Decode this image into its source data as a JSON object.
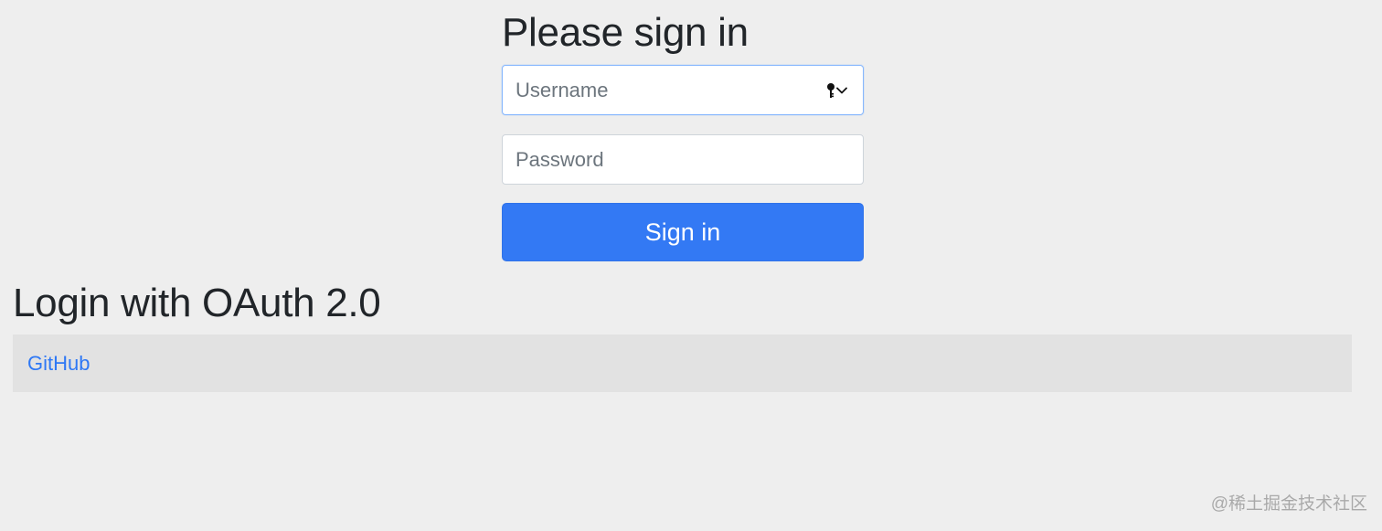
{
  "signin": {
    "heading": "Please sign in",
    "username": {
      "placeholder": "Username",
      "value": ""
    },
    "password": {
      "placeholder": "Password",
      "value": ""
    },
    "submit_label": "Sign in",
    "autofill_icon": "key-icon",
    "autofill_chevron_icon": "chevron-down-icon"
  },
  "oauth": {
    "heading": "Login with OAuth 2.0",
    "providers": [
      {
        "label": "GitHub"
      }
    ]
  },
  "watermark": "@稀土掘金技术社区",
  "colors": {
    "background": "#eeeeee",
    "primary_button": "#3379f4",
    "link": "#2e78f5",
    "table_row": "#e2e2e2",
    "focus_border": "#86b7fe"
  }
}
